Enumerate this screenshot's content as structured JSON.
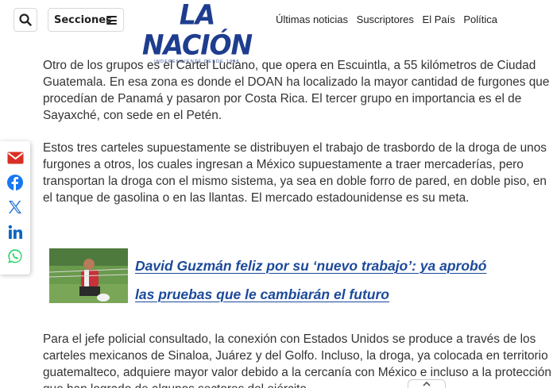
{
  "header": {
    "sections_label": "Secciones",
    "logo_text": "LA NACIÓN",
    "logo_tagline": "INDEPENDIENTE DESDE 1946",
    "nav": [
      "Últimas noticias",
      "Suscriptores",
      "El País",
      "Política"
    ]
  },
  "article": {
    "paragraphs": [
      "Otro de los grupos es el Cartel Luciano, que opera en Escuintla, a 55 kilómetros de Ciudad Guatemala. En esa zona es donde el DOAN ha localizado la mayor cantidad de furgones que procedían de Panamá y pasaron por Costa Rica. El tercer grupo en importancia es el de Sayaxché, con sede en el Petén.",
      "Estos tres carteles supuestamente se distribuyen el trabajo de trasbordo de la droga de unos furgones a otros, los cuales ingresan a México supuestamente a traer mercaderías, pero transportan la droga con el mismo sistema, ya sea en doble forro de pared, en doble piso, en el tanque de gasolina o en las llantas. El mercado estadounidense es su meta.",
      "Para el jefe policial consultado, la conexión con Estados Unidos se produce a través de los carteles mexicanos de Sinaloa, Juárez y del Golfo. Incluso, la droga, ya colocada en territorio guatemalteco, adquiere mayor valor debido a la cercanía con México e incluso a la protección que han logrado de algunos sectores del ejército"
    ],
    "related_title": "David Guzmán feliz por su ‘nuevo trabajo’: ya aprobó las pruebas que le cambiarán el futuro"
  },
  "colors": {
    "brand": "#1e3d8f",
    "link": "#1c4a9b",
    "email": "#d93025",
    "facebook": "#1877f2",
    "x": "#1d6fd1",
    "linkedin": "#0a66c2",
    "whatsapp": "#25d366"
  },
  "icons": [
    "search-icon",
    "menu-icon",
    "email-icon",
    "facebook-icon",
    "x-icon",
    "linkedin-icon",
    "whatsapp-icon",
    "chevron-up-icon"
  ]
}
